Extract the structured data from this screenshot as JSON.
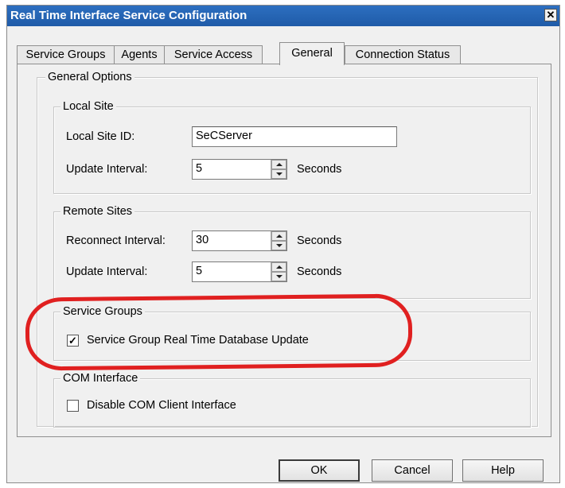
{
  "window": {
    "title": "Real Time Interface Service Configuration",
    "close_glyph": "✕"
  },
  "tabs": [
    {
      "label": "Service Groups"
    },
    {
      "label": "Agents"
    },
    {
      "label": "Service Access"
    },
    {
      "label": "General",
      "active": true
    },
    {
      "label": "Connection Status"
    }
  ],
  "general_options": {
    "legend": "General Options",
    "local_site": {
      "legend": "Local Site",
      "site_id_label": "Local Site ID:",
      "site_id_value": "SeCServer",
      "update_label": "Update Interval:",
      "update_value": "5",
      "update_unit": "Seconds"
    },
    "remote_sites": {
      "legend": "Remote Sites",
      "reconnect_label": "Reconnect Interval:",
      "reconnect_value": "30",
      "reconnect_unit": "Seconds",
      "update_label": "Update Interval:",
      "update_value": "5",
      "update_unit": "Seconds"
    },
    "service_groups": {
      "legend": "Service Groups",
      "checkbox_label": "Service Group Real Time Database Update",
      "checked": true,
      "check_glyph": "✓"
    },
    "com_interface": {
      "legend": "COM Interface",
      "checkbox_label": "Disable COM Client Interface",
      "checked": false
    }
  },
  "buttons": {
    "ok": "OK",
    "cancel": "Cancel",
    "help": "Help"
  },
  "annotation_color": "#e02020"
}
